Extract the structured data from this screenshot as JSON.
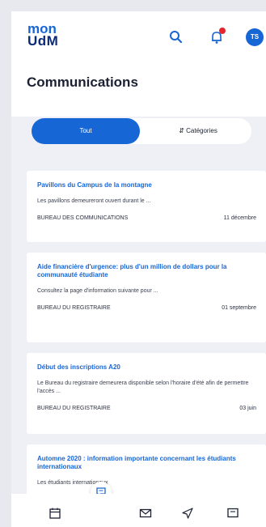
{
  "app": {
    "logo_line1": "mon",
    "logo_line2a": "U",
    "logo_line2b": "dM",
    "user_initials": "TS"
  },
  "header": {
    "title": "Communications"
  },
  "filter": {
    "all_label": "Tout",
    "categories_label": "Catégories"
  },
  "communications": [
    {
      "title": "Pavillons du Campus de la montagne",
      "excerpt": "Les pavillons demeureront ouvert durant le ...",
      "source": "BUREAU DES COMMUNICATIONS",
      "date": "11 décembre"
    },
    {
      "title": "Aide financière d'urgence: plus d'un million de dollars pour la communauté étudiante",
      "excerpt": "Consultez la page d'information suivante pour ...",
      "source": "BUREAU DU REGISTRAIRE",
      "date": "01 septembre"
    },
    {
      "title": "Début des inscriptions A20",
      "excerpt": "Le Bureau du registraire demeurera disponible selon l'horaire d'été afin de permettre l'accès ...",
      "source": "BUREAU DU REGISTRAIRE",
      "date": "03 juin"
    },
    {
      "title": "Automne 2020 : information importante concernant les étudiants internationaux",
      "excerpt": "Les étudiants internationaux",
      "source": "",
      "date": ""
    }
  ],
  "colors": {
    "accent": "#1766d6",
    "badge": "#e5262e",
    "background": "#eef0f5"
  },
  "icons": {
    "search": "search-icon",
    "bell": "bell-icon",
    "calendar": "calendar-icon",
    "mail": "mail-icon",
    "send": "send-icon",
    "screen": "screen-icon",
    "chat": "chat-icon"
  }
}
